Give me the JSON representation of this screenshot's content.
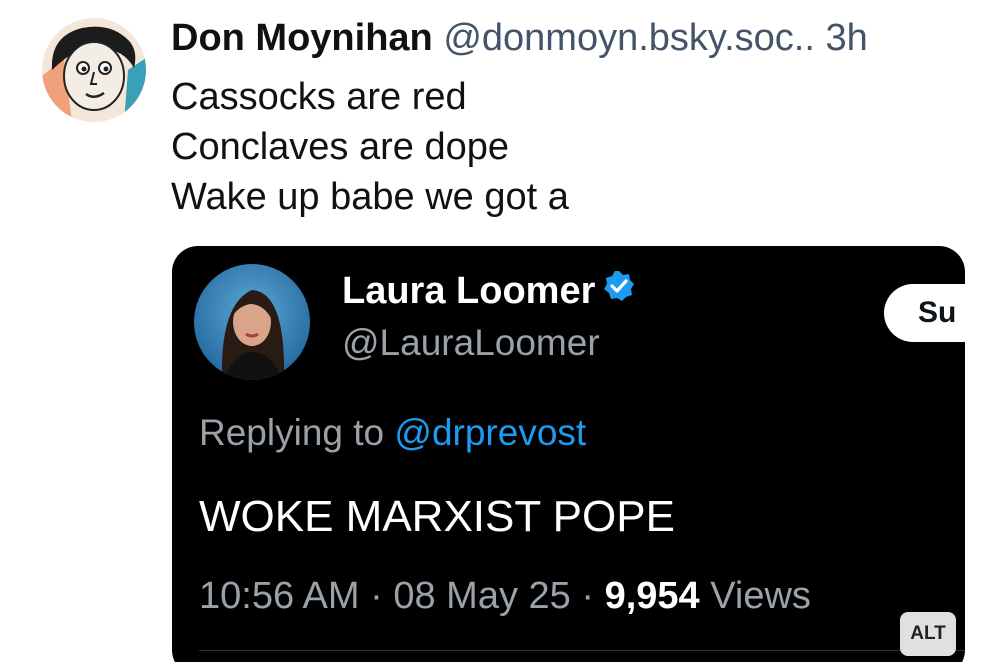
{
  "post": {
    "author": {
      "display_name": "Don Moynihan",
      "handle": "@donmoyn.bsky.soc..",
      "avatar_icon": "cartoon-face-avatar"
    },
    "time_ago": "3h",
    "text_lines": [
      "Cassocks are red",
      "Conclaves are dope",
      "Wake up babe we got a"
    ]
  },
  "embed": {
    "author": {
      "display_name": "Laura Loomer",
      "handle": "@LauraLoomer",
      "verified_icon": "verified-badge-icon"
    },
    "subscribe_label": "Su",
    "replying_prefix": "Replying to",
    "replying_mention": "@drprevost",
    "body": "WOKE MARXIST POPE",
    "time": "10:56 AM",
    "separator": "·",
    "date": "08 May 25",
    "views_count": "9,954",
    "views_label": "Views",
    "alt_label": "ALT"
  },
  "colors": {
    "background": "#ffffff",
    "text_primary": "#111111",
    "text_secondary": "#43536a",
    "embed_background": "#000000",
    "embed_secondary": "#9aa1a8",
    "mention": "#1d9bf0",
    "verified": "#1d9bf0"
  }
}
